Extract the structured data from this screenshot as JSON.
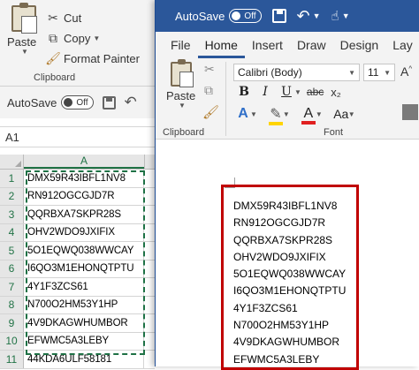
{
  "excel": {
    "ribbon": {
      "paste_label": "Paste",
      "cut_label": "Cut",
      "copy_label": "Copy",
      "format_painter_label": "Format Painter",
      "clipboard_group_label": "Clipboard"
    },
    "quick_access": {
      "autosave_label": "AutoSave",
      "autosave_state": "Off"
    },
    "name_box": "A1",
    "column_header": "A",
    "rows": [
      {
        "num": "1",
        "value": "DMX59R43IBFL1NV8"
      },
      {
        "num": "2",
        "value": "RN912OGCGJD7R"
      },
      {
        "num": "3",
        "value": "QQRBXA7SKPR28S"
      },
      {
        "num": "4",
        "value": "OHV2WDO9JXIFIX"
      },
      {
        "num": "5",
        "value": "5O1EQWQ038WWCAY"
      },
      {
        "num": "6",
        "value": "I6QO3M1EHONQTPTU"
      },
      {
        "num": "7",
        "value": "4Y1F3ZCS61"
      },
      {
        "num": "8",
        "value": "N700O2HM53Y1HP"
      },
      {
        "num": "9",
        "value": "4V9DKAGWHUMBOR"
      },
      {
        "num": "10",
        "value": "EFWMC5A3LEBY"
      },
      {
        "num": "11",
        "value": "44KDA6ULF58181"
      }
    ]
  },
  "word": {
    "title_bar": {
      "autosave_label": "AutoSave",
      "autosave_state": "Off"
    },
    "tabs": [
      "File",
      "Home",
      "Insert",
      "Draw",
      "Design",
      "Lay"
    ],
    "active_tab": "Home",
    "ribbon": {
      "paste_label": "Paste",
      "clipboard_group_label": "Clipboard",
      "font_name": "Calibri (Body)",
      "font_size": "11",
      "font_group_label": "Font",
      "bold": "B",
      "italic": "I",
      "underline": "U",
      "strikethrough": "abc",
      "subscript": "x₂"
    },
    "document_lines": [
      "DMX59R43IBFL1NV8",
      "RN912OGCGJD7R",
      "QQRBXA7SKPR28S",
      "OHV2WDO9JXIFIX",
      "5O1EQWQ038WWCAY",
      "I6QO3M1EHONQTPTU",
      "4Y1F3ZCS61",
      "N700O2HM53Y1HP",
      "4V9DKAGWHUMBOR",
      "EFWMC5A3LEBY"
    ]
  },
  "colors": {
    "word_brand": "#2b579a",
    "excel_brand": "#217346",
    "highlight_box": "#c00000",
    "font_color_bar": "#e02020",
    "text_effects_blue": "#2f6fc8"
  }
}
